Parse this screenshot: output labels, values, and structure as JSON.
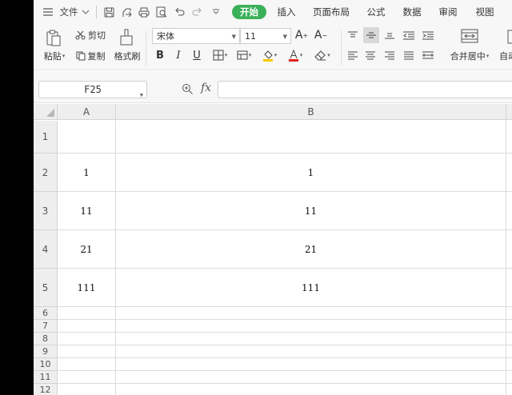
{
  "menu": {
    "hamburger_icon": "hamburger-icon",
    "file_label": "文件",
    "tabs": [
      "开始",
      "插入",
      "页面布局",
      "公式",
      "数据",
      "审阅",
      "视图"
    ],
    "active_tab_color": "#3bb05a"
  },
  "ribbon": {
    "paste_label": "粘贴",
    "cut_label": "剪切",
    "copy_label": "复制",
    "format_painter_label": "格式刷",
    "font_name": "宋体",
    "font_size": "11",
    "merge_center_label": "合并居中",
    "auto_wrap_label": "自动"
  },
  "formula_bar": {
    "cell_ref": "F25",
    "fx_label": "fx",
    "formula": ""
  },
  "sheet": {
    "columns": [
      "A",
      "B"
    ],
    "rows": [
      {
        "num": "1",
        "a": "",
        "b": ""
      },
      {
        "num": "2",
        "a": "1",
        "b": "1"
      },
      {
        "num": "3",
        "a": "11",
        "b": "11"
      },
      {
        "num": "4",
        "a": "21",
        "b": "21"
      },
      {
        "num": "5",
        "a": "111",
        "b": "111"
      },
      {
        "num": "6",
        "a": "",
        "b": ""
      },
      {
        "num": "7",
        "a": "",
        "b": ""
      },
      {
        "num": "8",
        "a": "",
        "b": ""
      },
      {
        "num": "9",
        "a": "",
        "b": ""
      },
      {
        "num": "10",
        "a": "",
        "b": ""
      },
      {
        "num": "11",
        "a": "",
        "b": ""
      },
      {
        "num": "12",
        "a": "",
        "b": ""
      }
    ]
  }
}
